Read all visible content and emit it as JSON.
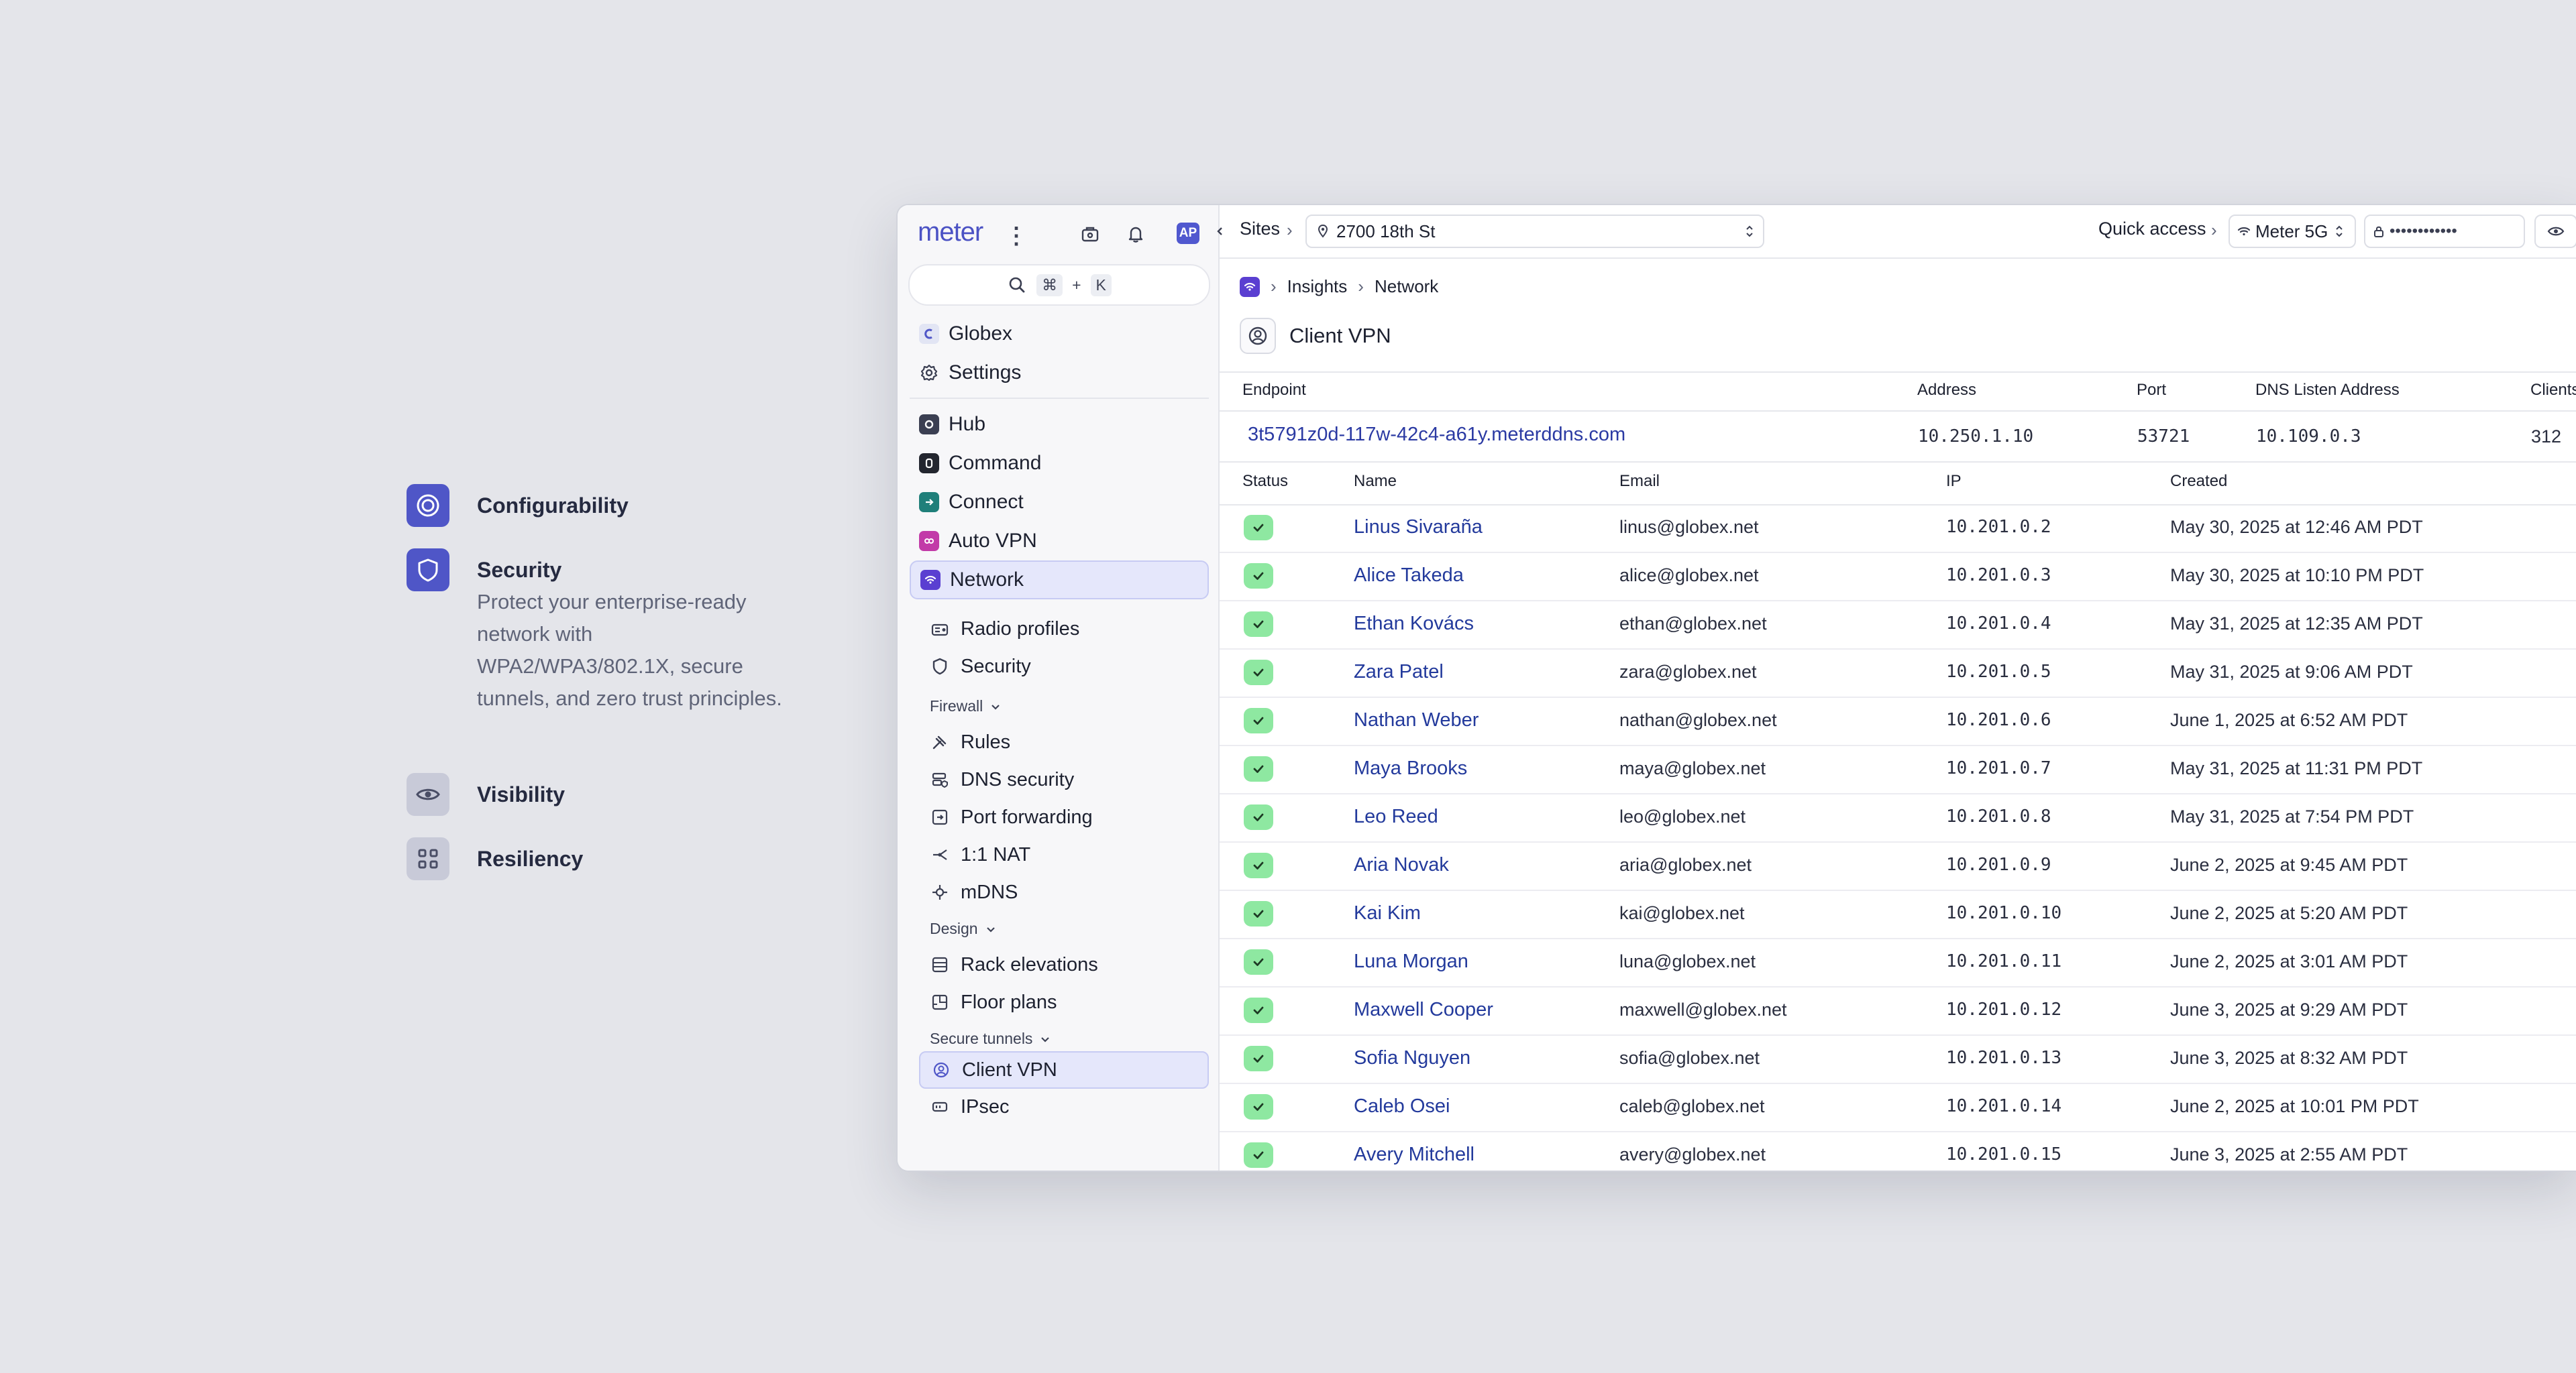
{
  "features": [
    {
      "title": "Configurability",
      "active": true,
      "icon": "target-icon"
    },
    {
      "title": "Security",
      "active": true,
      "icon": "shield-icon",
      "description": "Protect your enterprise-ready network with WPA2/WPA3/802.1X, secure tunnels, and zero trust principles."
    },
    {
      "title": "Visibility",
      "active": false,
      "icon": "eye-icon"
    },
    {
      "title": "Resiliency",
      "active": false,
      "icon": "nodes-icon"
    }
  ],
  "sidebar": {
    "logo": "meter",
    "user_badge": "AP",
    "search": {
      "key1": "⌘",
      "plus": "+",
      "key2": "K"
    },
    "top_items": [
      {
        "label": "Globex"
      },
      {
        "label": "Settings"
      }
    ],
    "apps": [
      {
        "label": "Hub"
      },
      {
        "label": "Command"
      },
      {
        "label": "Connect"
      },
      {
        "label": "Auto VPN"
      },
      {
        "label": "Network"
      }
    ],
    "network_items": [
      {
        "label": "Radio profiles"
      },
      {
        "label": "Security"
      }
    ],
    "firewall": {
      "label": "Firewall",
      "items": [
        {
          "label": "Rules"
        },
        {
          "label": "DNS security"
        },
        {
          "label": "Port forwarding"
        },
        {
          "label": "1:1 NAT"
        },
        {
          "label": "mDNS"
        }
      ]
    },
    "design": {
      "label": "Design",
      "items": [
        {
          "label": "Rack elevations"
        },
        {
          "label": "Floor plans"
        }
      ]
    },
    "secure_tunnels": {
      "label": "Secure tunnels",
      "items": [
        {
          "label": "Client VPN"
        },
        {
          "label": "IPsec"
        }
      ]
    }
  },
  "topbar": {
    "sites_label": "Sites",
    "site": "2700 18th St",
    "quick_access": "Quick access",
    "ssid": "Meter 5G",
    "password": "••••••••••••"
  },
  "breadcrumb": [
    "Insights",
    "Network"
  ],
  "page_title": "Client VPN",
  "server": {
    "headers": {
      "endpoint": "Endpoint",
      "address": "Address",
      "port": "Port",
      "dns": "DNS Listen Address",
      "clients": "Clients"
    },
    "endpoint": "3t5791z0d-117w-42c4-a61y.meterddns.com",
    "address": "10.250.1.10",
    "port": "53721",
    "dns": "10.109.0.3",
    "clients": "312"
  },
  "clients_table": {
    "headers": {
      "status": "Status",
      "name": "Name",
      "email": "Email",
      "ip": "IP",
      "created": "Created"
    },
    "rows": [
      {
        "name": "Linus Sivaraña",
        "email": "linus@globex.net",
        "ip": "10.201.0.2",
        "created": "May 30, 2025 at 12:46 AM PDT"
      },
      {
        "name": "Alice Takeda",
        "email": "alice@globex.net",
        "ip": "10.201.0.3",
        "created": "May 30, 2025 at 10:10 PM PDT"
      },
      {
        "name": "Ethan Kovács",
        "email": "ethan@globex.net",
        "ip": "10.201.0.4",
        "created": "May 31, 2025 at 12:35 AM PDT"
      },
      {
        "name": "Zara Patel",
        "email": "zara@globex.net",
        "ip": "10.201.0.5",
        "created": "May 31, 2025 at 9:06 AM PDT"
      },
      {
        "name": "Nathan Weber",
        "email": "nathan@globex.net",
        "ip": "10.201.0.6",
        "created": "June 1, 2025 at 6:52 AM PDT"
      },
      {
        "name": "Maya Brooks",
        "email": "maya@globex.net",
        "ip": "10.201.0.7",
        "created": "May 31, 2025 at 11:31 PM PDT"
      },
      {
        "name": "Leo Reed",
        "email": "leo@globex.net",
        "ip": "10.201.0.8",
        "created": "May 31, 2025 at 7:54 PM PDT"
      },
      {
        "name": "Aria Novak",
        "email": "aria@globex.net",
        "ip": "10.201.0.9",
        "created": "June 2, 2025 at 9:45 AM PDT"
      },
      {
        "name": "Kai Kim",
        "email": "kai@globex.net",
        "ip": "10.201.0.10",
        "created": "June 2, 2025 at 5:20 AM PDT"
      },
      {
        "name": "Luna Morgan",
        "email": "luna@globex.net",
        "ip": "10.201.0.11",
        "created": "June 2, 2025 at 3:01 AM PDT"
      },
      {
        "name": "Maxwell Cooper",
        "email": "maxwell@globex.net",
        "ip": "10.201.0.12",
        "created": "June 3, 2025 at 9:29 AM PDT"
      },
      {
        "name": "Sofia Nguyen",
        "email": "sofia@globex.net",
        "ip": "10.201.0.13",
        "created": "June 3, 2025 at 8:32 AM PDT"
      },
      {
        "name": "Caleb Osei",
        "email": "caleb@globex.net",
        "ip": "10.201.0.14",
        "created": "June 2, 2025 at 10:01 PM PDT"
      },
      {
        "name": "Avery Mitchell",
        "email": "avery@globex.net",
        "ip": "10.201.0.15",
        "created": "June 3, 2025 at 2:55 AM PDT"
      }
    ]
  },
  "colors": {
    "accent": "#4f56c7",
    "status_ok": "#8ee8a1",
    "link": "#233a9c"
  }
}
